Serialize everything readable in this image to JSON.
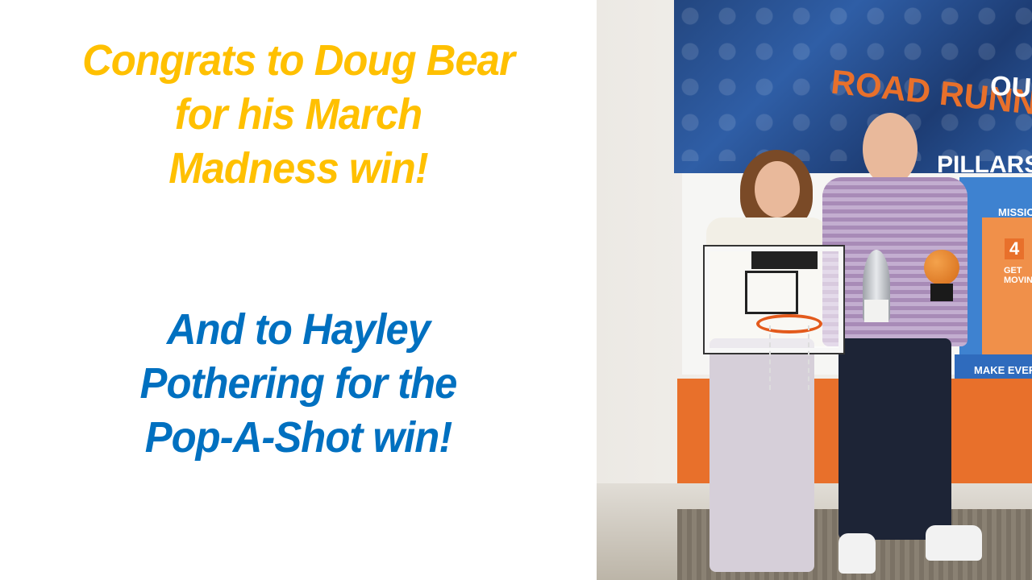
{
  "headline_gold": {
    "line1": "Congrats to Doug Bear",
    "line2": "for his March",
    "line3": "Madness win!"
  },
  "headline_blue": {
    "line1": "And to Hayley",
    "line2": "Pothering for the",
    "line3": "Pop-A-Shot win!"
  },
  "photo": {
    "mural_our": "OUR",
    "mural_road": "ROAD RUNNER S",
    "mural_pillars": "PILLARS",
    "mural_mission": "MISSIO",
    "mural_number": "4",
    "mural_get_moving": "GET MOVING",
    "mural_make_every": "MAKE EVERY MI"
  },
  "colors": {
    "gold": "#ffc000",
    "blue": "#0070c0",
    "background": "#ffffff"
  }
}
